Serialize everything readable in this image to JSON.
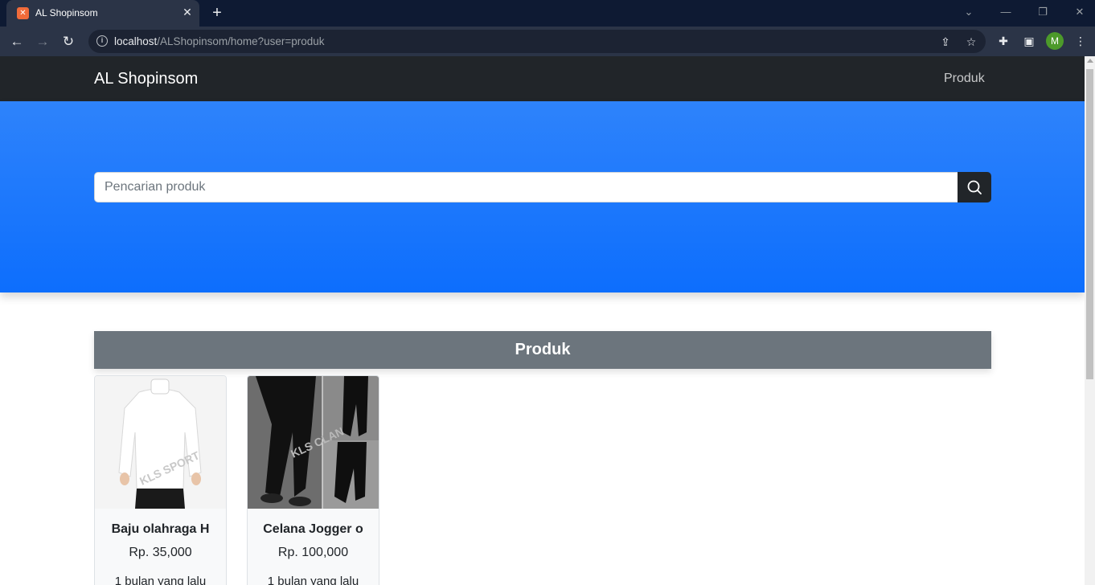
{
  "browser": {
    "tab_title": "AL Shopinsom",
    "tab_favicon": "xampp-favicon-icon",
    "url_host": "localhost",
    "url_path": "/ALShopinsom/home?user=produk",
    "profile_initial": "M"
  },
  "navbar": {
    "brand": "AL Shopinsom",
    "link": "Produk"
  },
  "search": {
    "placeholder": "Pencarian produk"
  },
  "section": {
    "title": "Produk"
  },
  "products": [
    {
      "name": "Baju olahraga H",
      "price": "Rp. 35,000",
      "posted": "1 bulan yang lalu",
      "image_watermark": "KLS SPORT"
    },
    {
      "name": "Celana Jogger o",
      "price": "Rp. 100,000",
      "posted": "1 bulan yang lalu",
      "image_watermark": "KLS CLAN"
    }
  ],
  "colors": {
    "navbar": "#212529",
    "hero": "#0d6efd",
    "section_header": "#6c757d",
    "tabbar": "#0e1a33"
  }
}
